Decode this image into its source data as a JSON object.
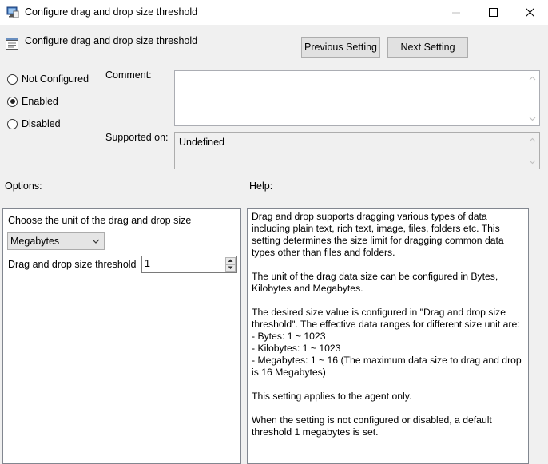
{
  "window": {
    "title": "Configure drag and drop size threshold",
    "controls": [
      "minimize",
      "maximize",
      "close"
    ]
  },
  "header": {
    "title": "Configure drag and drop size threshold",
    "previous_label": "Previous Setting",
    "next_label": "Next Setting"
  },
  "state_options": [
    {
      "label": "Not Configured",
      "selected": false
    },
    {
      "label": "Enabled",
      "selected": true
    },
    {
      "label": "Disabled",
      "selected": false
    }
  ],
  "comment": {
    "label": "Comment:",
    "value": ""
  },
  "supported_on": {
    "label": "Supported on:",
    "value": "Undefined"
  },
  "options": {
    "heading": "Options:",
    "unit_label": "Choose the unit of the drag and drop size",
    "unit_value": "Megabytes",
    "threshold_label": "Drag and drop size threshold",
    "threshold_value": "1"
  },
  "help": {
    "heading": "Help:",
    "text": "Drag and drop supports dragging various types of data including plain text, rich text, image, files, folders etc. This setting determines the size limit for dragging common data types other than files and folders.\n\nThe unit of the drag data size can be configured in Bytes, Kilobytes and Megabytes.\n\nThe desired size value is configured in \"Drag and drop size threshold\". The effective data ranges for different size unit are:\n  - Bytes: 1 ~ 1023\n  - Kilobytes: 1 ~ 1023\n  - Megabytes: 1 ~ 16 (The maximum data size to drag and drop is 16 Megabytes)\n\nThis setting applies to the agent only.\n\nWhen the setting is not configured or disabled, a default threshold 1 megabytes is set."
  }
}
